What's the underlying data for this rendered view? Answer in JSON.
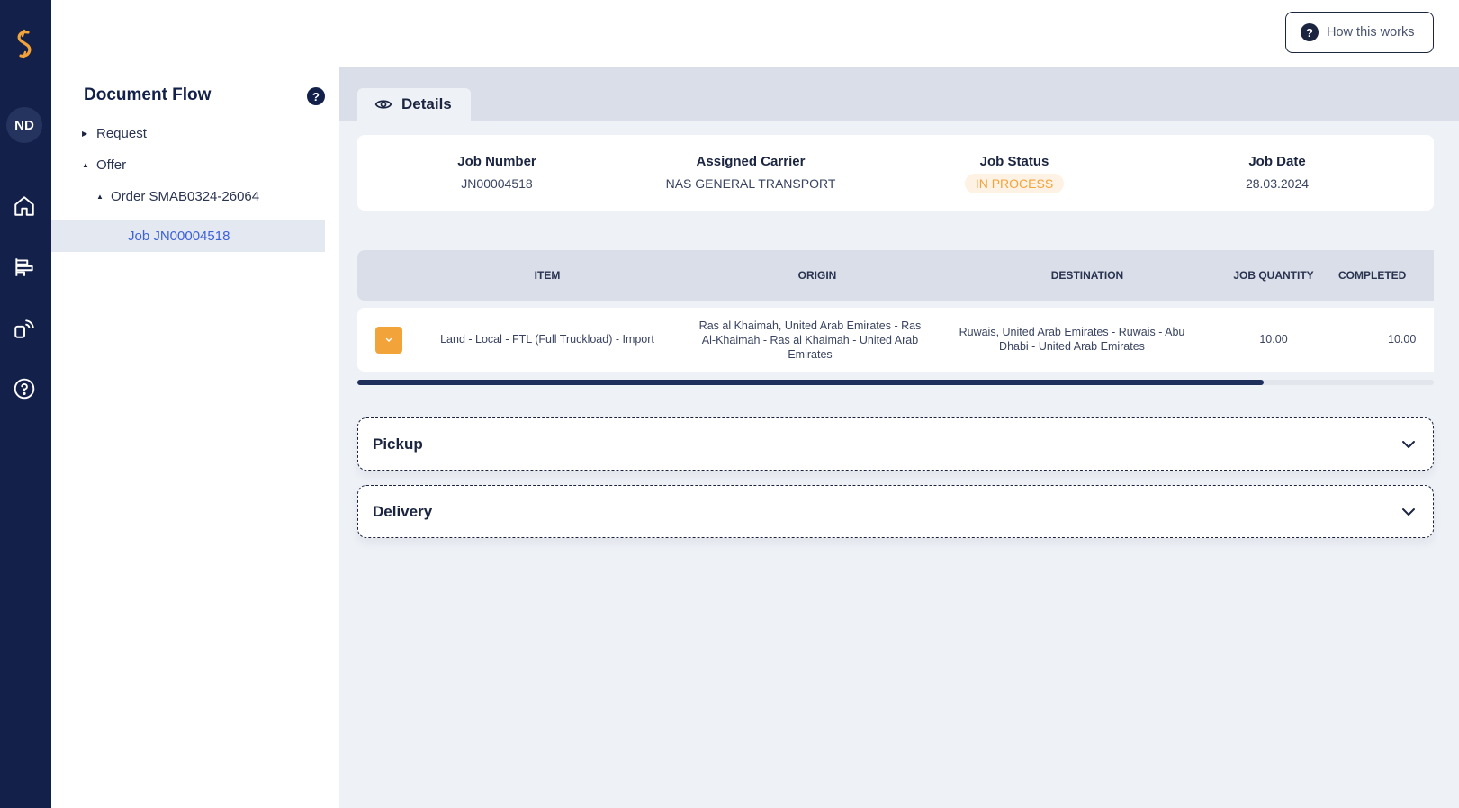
{
  "sidebar": {
    "avatar_initials": "ND",
    "nav": [
      {
        "icon": "home-icon"
      },
      {
        "icon": "reports-icon"
      },
      {
        "icon": "broadcast-icon"
      },
      {
        "icon": "help-circle-icon"
      }
    ]
  },
  "header": {
    "how_this_works": "How this works"
  },
  "document_flow": {
    "title": "Document Flow",
    "tree": {
      "request": "Request",
      "offer": "Offer",
      "order": "Order SMAB0324-26064",
      "job": "Job JN00004518"
    }
  },
  "tabs": {
    "details": "Details"
  },
  "summary": {
    "job_number_label": "Job Number",
    "job_number": "JN00004518",
    "carrier_label": "Assigned Carrier",
    "carrier": "NAS GENERAL TRANSPORT",
    "status_label": "Job Status",
    "status": "IN PROCESS",
    "date_label": "Job Date",
    "date": "28.03.2024"
  },
  "table": {
    "headers": {
      "item": "ITEM",
      "origin": "ORIGIN",
      "destination": "DESTINATION",
      "job_quantity": "JOB QUANTITY",
      "completed": "COMPLETED"
    },
    "rows": [
      {
        "item": "Land - Local - FTL (Full Truckload) - Import",
        "origin": "Ras al Khaimah, United Arab Emirates - Ras Al-Khaimah - Ras al Khaimah - United Arab Emirates",
        "destination": "Ruwais, United Arab Emirates - Ruwais - Abu Dhabi - United Arab Emirates",
        "job_quantity": "10.00",
        "completed": "10.00"
      }
    ]
  },
  "sections": {
    "pickup": "Pickup",
    "delivery": "Delivery"
  },
  "colors": {
    "rail": "#13204a",
    "accent": "#f2a33a",
    "selected": "#e4e8f0"
  }
}
